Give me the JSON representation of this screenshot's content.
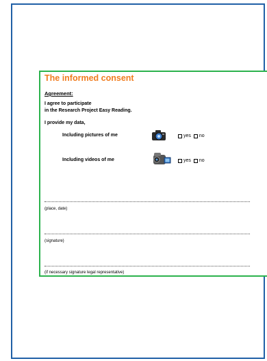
{
  "form": {
    "title": "The informed consent",
    "heading": "Agreement:",
    "statement_line1": "I agree to participate",
    "statement_line2": "in the Research Project Easy Reading.",
    "data_line": "I provide my data,",
    "options": [
      {
        "label": "Including pictures of me",
        "icon": "camera-icon",
        "yes": "yes",
        "no": "no"
      },
      {
        "label": "Including videos of me",
        "icon": "video-camera-icon",
        "yes": "yes",
        "no": "no"
      }
    ],
    "signature_fields": [
      {
        "caption": "(place, date)"
      },
      {
        "caption": "(signature)"
      },
      {
        "caption": "(if necessary signature legal representative)"
      }
    ]
  },
  "colors": {
    "page_border": "#1f5fa6",
    "box_border": "#2bb24c",
    "title": "#f07c1f"
  }
}
